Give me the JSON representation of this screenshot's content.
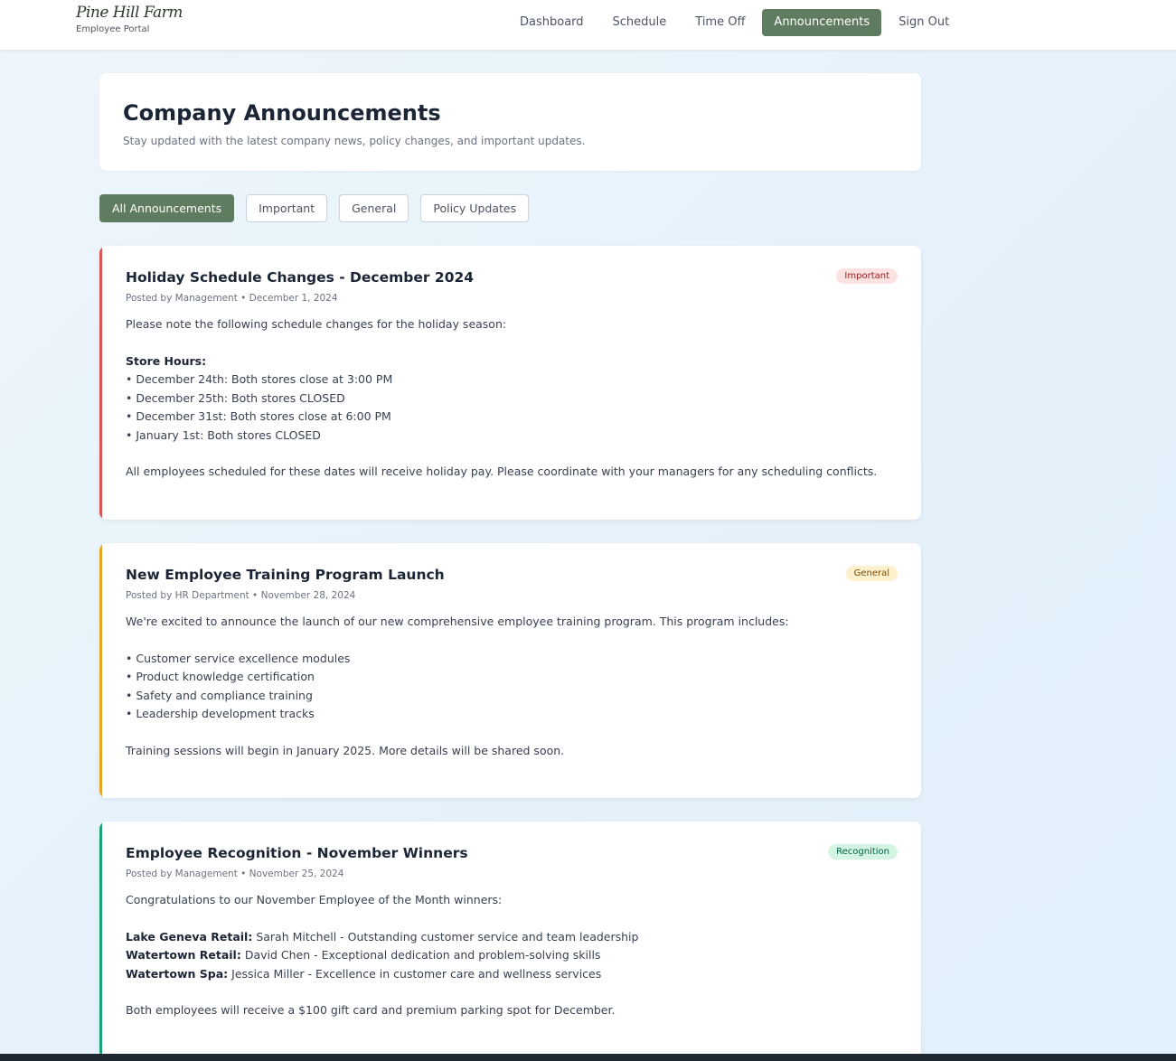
{
  "brand": {
    "name": "Pine Hill Farm",
    "subtitle": "Employee Portal"
  },
  "nav": [
    {
      "label": "Dashboard",
      "active": false
    },
    {
      "label": "Schedule",
      "active": false
    },
    {
      "label": "Time Off",
      "active": false
    },
    {
      "label": "Announcements",
      "active": true
    },
    {
      "label": "Sign Out",
      "active": false
    }
  ],
  "page": {
    "title": "Company Announcements",
    "subtitle": "Stay updated with the latest company news, policy changes, and important updates."
  },
  "filters": [
    {
      "label": "All Announcements",
      "active": true
    },
    {
      "label": "Important",
      "active": false
    },
    {
      "label": "General",
      "active": false
    },
    {
      "label": "Policy Updates",
      "active": false
    }
  ],
  "announcements": [
    {
      "title": "Holiday Schedule Changes - December 2024",
      "meta": "Posted by Management • December 1, 2024",
      "badge": "Important",
      "accent": "#e05252",
      "badge_bg": "#fde2e2",
      "badge_color": "#991b1b",
      "intro": "Please note the following schedule changes for the holiday season:",
      "section_heading": "Store Hours:",
      "lines": [
        "• December 24th: Both stores close at 3:00 PM",
        "• December 25th: Both stores CLOSED",
        "• December 31st: Both stores close at 6:00 PM",
        "• January 1st: Both stores CLOSED"
      ],
      "outro": "All employees scheduled for these dates will receive holiday pay. Please coordinate with your managers for any scheduling conflicts."
    },
    {
      "title": "New Employee Training Program Launch",
      "meta": "Posted by HR Department • November 28, 2024",
      "badge": "General",
      "accent": "#e8a422",
      "badge_bg": "#fdf0cc",
      "badge_color": "#7c4a03",
      "intro": "We're excited to announce the launch of our new comprehensive employee training program. This program includes:",
      "lines": [
        "• Customer service excellence modules",
        "• Product knowledge certification",
        "• Safety and compliance training",
        "• Leadership development tracks"
      ],
      "outro": "Training sessions will begin in January 2025. More details will be shared soon."
    },
    {
      "title": "Employee Recognition - November Winners",
      "meta": "Posted by Management • November 25, 2024",
      "badge": "Recognition",
      "accent": "#1aa372",
      "badge_bg": "#d4f5e4",
      "badge_color": "#065f46",
      "intro": "Congratulations to our November Employee of the Month winners:",
      "winners": [
        {
          "location": "Lake Geneva Retail:",
          "text": " Sarah Mitchell - Outstanding customer service and team leadership"
        },
        {
          "location": "Watertown Retail:",
          "text": " David Chen - Exceptional dedication and problem-solving skills"
        },
        {
          "location": "Watertown Spa:",
          "text": " Jessica Miller - Excellence in customer care and wellness services"
        }
      ],
      "outro": "Both employees will receive a $100 gift card and premium parking spot for December."
    }
  ]
}
